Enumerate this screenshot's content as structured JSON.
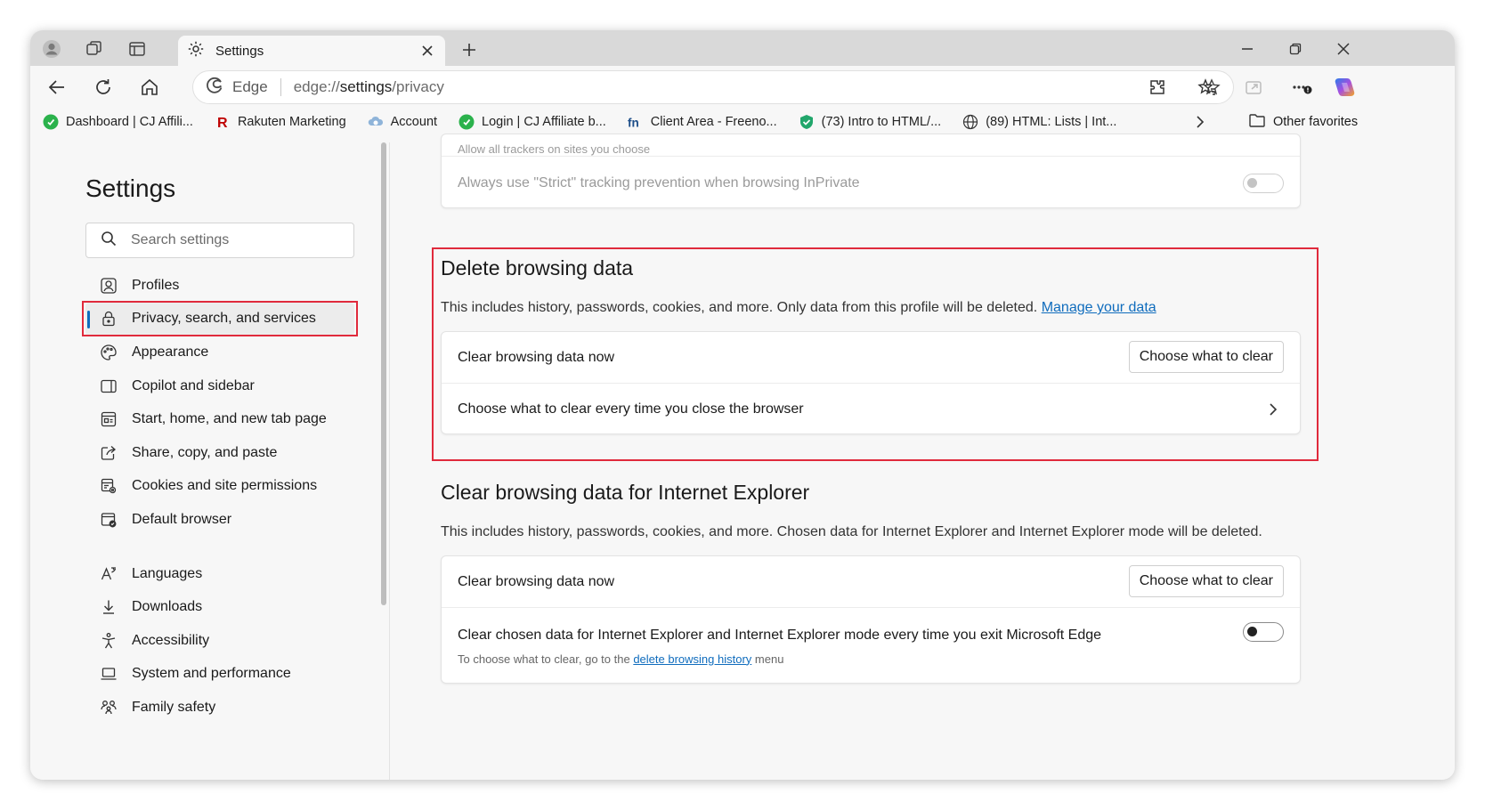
{
  "tab": {
    "title": "Settings"
  },
  "omnibox": {
    "brand": "Edge",
    "url_prefix": "edge://",
    "url_host": "settings",
    "url_path": "/privacy"
  },
  "favorites": {
    "items": [
      {
        "label": "Dashboard | CJ Affili..."
      },
      {
        "label": "Rakuten Marketing"
      },
      {
        "label": "Account"
      },
      {
        "label": "Login | CJ Affiliate b..."
      },
      {
        "label": "Client Area - Freeno..."
      },
      {
        "label": "(73) Intro to HTML/..."
      },
      {
        "label": "(89) HTML: Lists | Int..."
      }
    ],
    "other": "Other favorites"
  },
  "sidebar": {
    "title": "Settings",
    "search_placeholder": "Search settings",
    "items": [
      {
        "label": "Profiles"
      },
      {
        "label": "Privacy, search, and services"
      },
      {
        "label": "Appearance"
      },
      {
        "label": "Copilot and sidebar"
      },
      {
        "label": "Start, home, and new tab page"
      },
      {
        "label": "Share, copy, and paste"
      },
      {
        "label": "Cookies and site permissions"
      },
      {
        "label": "Default browser"
      },
      {
        "label": "Languages"
      },
      {
        "label": "Downloads"
      },
      {
        "label": "Accessibility"
      },
      {
        "label": "System and performance"
      },
      {
        "label": "Family safety"
      }
    ]
  },
  "tracking": {
    "partial_text": "Allow all trackers on sites you choose",
    "strict_label": "Always use \"Strict\" tracking prevention when browsing InPrivate"
  },
  "delete_data": {
    "heading": "Delete browsing data",
    "description": "This includes history, passwords, cookies, and more. Only data from this profile will be deleted.",
    "manage_link": "Manage your data",
    "clear_now_label": "Clear browsing data now",
    "choose_button": "Choose what to clear",
    "on_close_label": "Choose what to clear every time you close the browser"
  },
  "ie_data": {
    "heading": "Clear browsing data for Internet Explorer",
    "description": "This includes history, passwords, cookies, and more. Chosen data for Internet Explorer and Internet Explorer mode will be deleted.",
    "clear_now_label": "Clear browsing data now",
    "choose_button": "Choose what to clear",
    "exit_label": "Clear chosen data for Internet Explorer and Internet Explorer mode every time you exit Microsoft Edge",
    "hint_prefix": "To choose what to clear, go to the",
    "hint_link": "delete browsing history",
    "hint_suffix": "menu"
  },
  "colors": {
    "accent": "#0f6cbd",
    "highlight": "#e02a3c"
  }
}
